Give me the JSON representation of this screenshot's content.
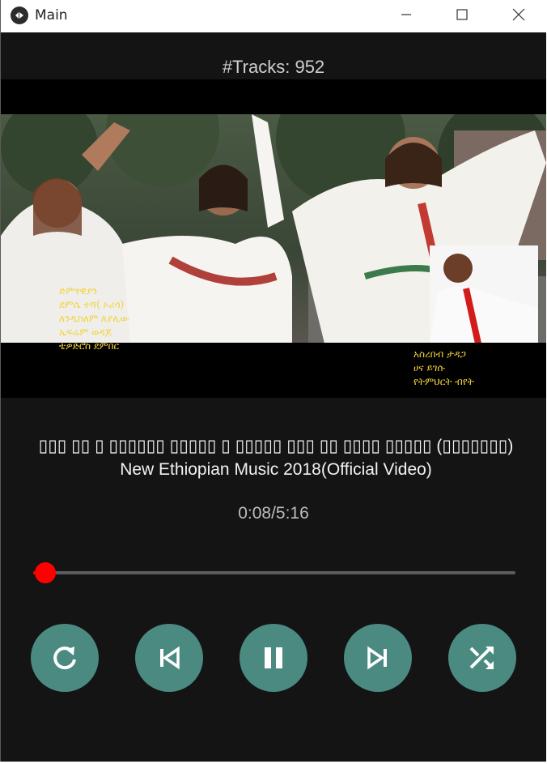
{
  "window": {
    "title": "Main",
    "minimize_icon": "minimize-icon",
    "maximize_icon": "maximize-icon",
    "close_icon": "close-icon"
  },
  "player": {
    "tracks_label": "#Tracks: 952",
    "song_title": "▯▯▯ ▯▯ ▯ ▯▯▯▯▯▯ ▯▯▯▯▯ ▯ ▯▯▯▯▯ ▯▯▯ ▯▯ ▯▯▯▯ ▯▯▯▯▯ (▯▯▯▯▯▯▯) New Ethiopian Music 2018(Official Video)",
    "time": "0:08/5:16",
    "progress_fraction": 0.025,
    "video_overlay_left": [
      "ድምፃዊያን",
      "ደምሴ ተሻ( ኦሪሳ)",
      "ለንዲስለም ለያሊው",
      "ኤፍሬም ወዳጆ",
      "ቴዎድሮስ ደምበር"
    ],
    "video_overlay_right": [
      "አስረበብ ታዳጋ",
      "ሀና ይገሱ",
      "የትምህርት ብየት"
    ]
  },
  "controls": [
    {
      "name": "repeat-button",
      "icon": "repeat-icon"
    },
    {
      "name": "previous-button",
      "icon": "skip-previous-icon"
    },
    {
      "name": "pause-button",
      "icon": "pause-icon"
    },
    {
      "name": "next-button",
      "icon": "skip-next-icon"
    },
    {
      "name": "shuffle-button",
      "icon": "shuffle-icon"
    }
  ],
  "colors": {
    "background": "#141414",
    "accent": "#ff0000",
    "button": "#4a8a80"
  }
}
